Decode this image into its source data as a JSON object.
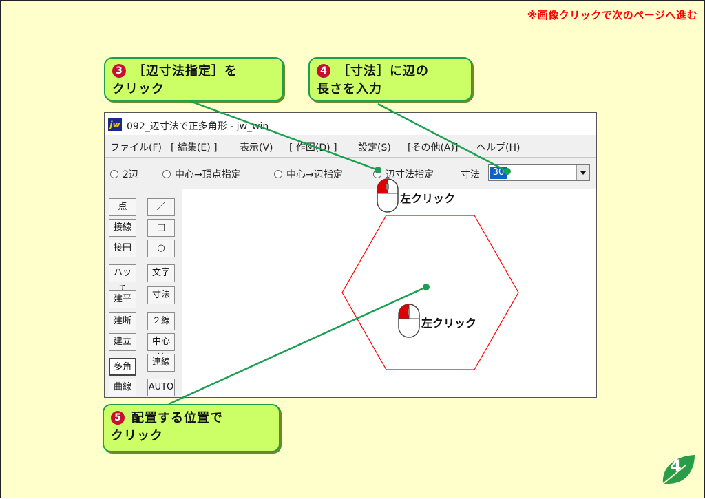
{
  "note": "※画像クリックで次のページへ進む",
  "callouts": [
    {
      "num": "3",
      "line1": "［辺寸法指定］を",
      "line2": "クリック"
    },
    {
      "num": "4",
      "line1": "［寸法］に辺の",
      "line2": "長さを入力"
    },
    {
      "num": "5",
      "line1": "配置する位置で",
      "line2": "クリック"
    }
  ],
  "window": {
    "logo": "jw",
    "title": "092_辺寸法で正多角形 - jw_win",
    "menu": [
      "ファイル(F)",
      "[ 編集(E) ]",
      "表示(V)",
      "[ 作図(D) ]",
      "設定(S)",
      "[その他(A)]",
      "ヘルプ(H)"
    ],
    "options": [
      "2辺",
      "中心→頂点指定",
      "中心→辺指定",
      "辺寸法指定"
    ],
    "dimension_label": "寸法",
    "dimension_value": "30",
    "tools_left": [
      "点",
      "接線",
      "接円",
      "ハッチ",
      "建平",
      "建断",
      "建立",
      "多角形",
      "曲線"
    ],
    "tools_right": [
      "／",
      "□",
      "○",
      "文字",
      "寸法",
      "２線",
      "中心線",
      "連線",
      "AUTO"
    ],
    "active_tool": "多角形"
  },
  "mouse_labels": [
    "左クリック",
    "左クリック"
  ],
  "page_number": "4",
  "colors": {
    "callout_bg": "#ccff66",
    "accent_green": "#1aa050",
    "note_red": "#ff0000",
    "polygon": "#ff0000",
    "page_bg": "#ffffcc"
  }
}
